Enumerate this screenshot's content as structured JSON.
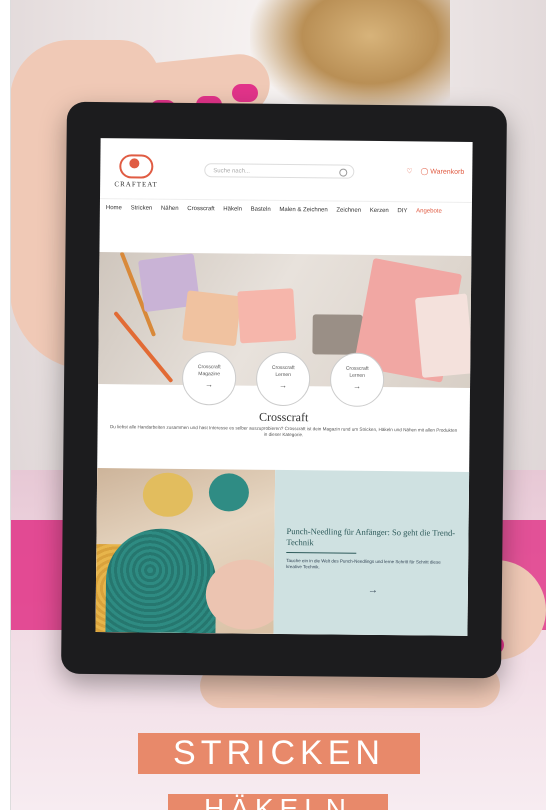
{
  "store": {
    "logo_text": "CRAFTEAT",
    "search_placeholder": "Suche nach...",
    "header_icons": [
      "♡",
      "◯ Warenkorb"
    ],
    "nav": [
      "Home",
      "Stricken",
      "Nähen",
      "Crosscraft",
      "Häkeln",
      "Basteln",
      "Malen & Zeichnen",
      "Zeichnen",
      "Kerzen",
      "DIY",
      "Angebote"
    ],
    "hero_circles": [
      {
        "lines": [
          "Crosscraft",
          "Magazine"
        ],
        "arrow": "→"
      },
      {
        "lines": [
          "Crosscraft",
          "Lernen"
        ],
        "arrow": "→"
      },
      {
        "lines": [
          "Crosscraft",
          "Lernen"
        ],
        "arrow": "→"
      }
    ],
    "section_title": "Crosscraft",
    "section_desc": "Du liebst alle Handarbeiten zusammen und hast Interesse es selber auszuprobieren? Crosscraft ist dein Magazin rund um Stricken, Häkeln und Nähen mit allen Produkten in dieser Kategorie.",
    "feature": {
      "title": "Punch-Needling für Anfänger: So geht die Trend-Technik",
      "text": "Tauche ein in die Welt des Punch-Needlings und lerne Schritt für Schritt diese kreative Technik.",
      "arrow": "→"
    }
  },
  "headline": {
    "line1": "STRICKEN",
    "line2": "HÄKELN"
  },
  "colors": {
    "accent": "#e05c43",
    "headline_bg": "#e8896a",
    "feature_panel": "#cfe1e1",
    "tablet": "#1c1c1e",
    "nail": "#e2338a"
  }
}
